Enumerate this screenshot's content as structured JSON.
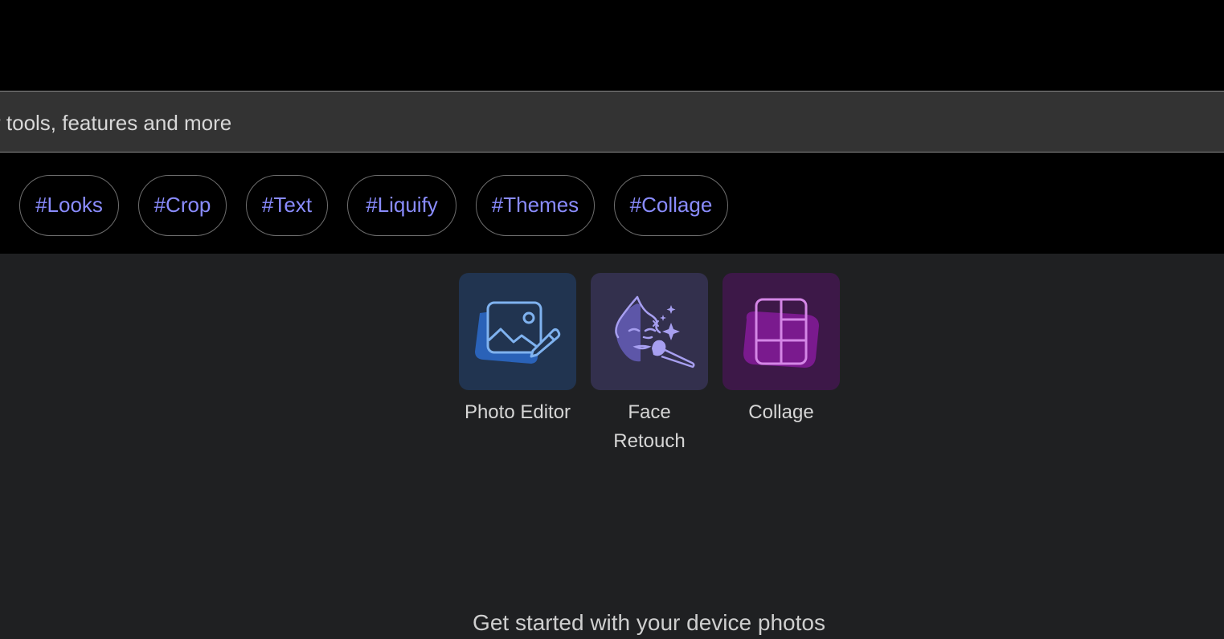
{
  "search": {
    "text": "r tools, features and more"
  },
  "chips": [
    {
      "label": "#Looks"
    },
    {
      "label": "#Crop"
    },
    {
      "label": "#Text"
    },
    {
      "label": "#Liquify"
    },
    {
      "label": "#Themes"
    },
    {
      "label": "#Collage"
    }
  ],
  "tools": [
    {
      "label": "Photo Editor",
      "icon": "photo-editor-icon",
      "bg": "#213450"
    },
    {
      "label_line1": "Face",
      "label_line2": "Retouch",
      "icon": "face-retouch-icon",
      "bg": "#33304d"
    },
    {
      "label": "Collage",
      "icon": "collage-icon",
      "bg": "#3d1848"
    }
  ],
  "footer": {
    "get_started": "Get started with your device photos"
  },
  "colors": {
    "chip_text": "#8a8cff",
    "background": "#1f2022",
    "bar": "#000000"
  }
}
